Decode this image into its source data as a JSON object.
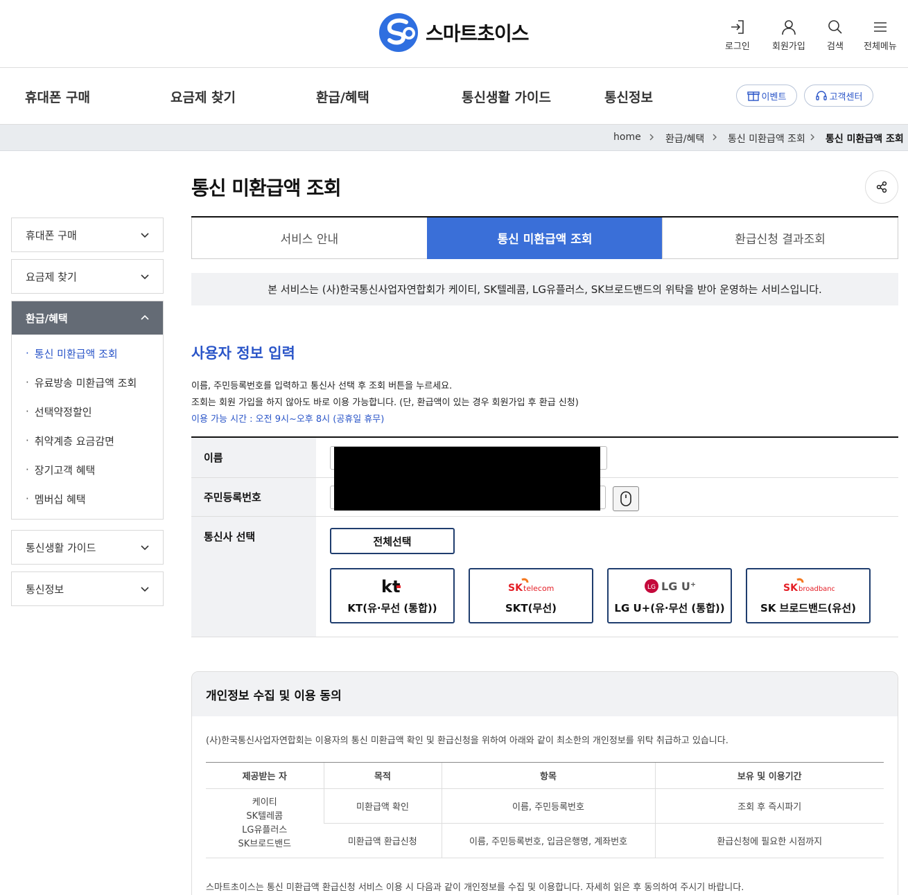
{
  "header": {
    "logo_text": "스마트초이스",
    "util": [
      {
        "label": "로그인",
        "icon": "login-icon"
      },
      {
        "label": "회원가입",
        "icon": "user-icon"
      },
      {
        "label": "검색",
        "icon": "search-icon"
      },
      {
        "label": "전체메뉴",
        "icon": "menu-icon"
      }
    ]
  },
  "gnb": {
    "items": [
      "휴대폰 구매",
      "요금제 찾기",
      "환급/혜택",
      "통신생활 가이드",
      "통신정보"
    ],
    "event_label": "이벤트",
    "support_label": "고객센터"
  },
  "breadcrumb": [
    "home",
    "환급/혜택",
    "통신 미환급액 조회",
    "통신 미환급액 조회"
  ],
  "sidebar": {
    "menus": [
      "휴대폰 구매",
      "요금제 찾기",
      "환급/혜택",
      "통신생활 가이드",
      "통신정보"
    ],
    "sub": [
      "통신 미환급액 조회",
      "유료방송 미환급액 조회",
      "선택약정할인",
      "취약계층 요금감면",
      "장기고객 혜택",
      "멤버십 혜택"
    ]
  },
  "page": {
    "title": "통신 미환급액 조회",
    "tabs": [
      "서비스 안내",
      "통신 미환급액 조회",
      "환급신청 결과조회"
    ],
    "notice": "본 서비스는 (사)한국통신사업자연합회가 케이티, SK텔레콤, LG유플러스, SK브로드밴드의 위탁을 받아 운영하는 서비스입니다.",
    "section_title": "사용자 정보 입력",
    "desc1": "이름, 주민등록번호를 입력하고 통신사 선택 후 조회 버튼을 누르세요.",
    "desc2": "조회는 회원 가입을 하지 않아도 바로 이용 가능합니다. (단, 환급액이 있는 경우 회원가입 후 환급 신청)",
    "hours": "이용 가능 시간 : 오전 9시~오후 8시 (공휴일 휴무)"
  },
  "form": {
    "name_label": "이름",
    "rrn_label": "주민등록번호",
    "carrier_label": "통신사 선택",
    "select_all": "전체선택",
    "carriers": [
      {
        "name": "KT(유·무선 (통합))",
        "logo": "kt"
      },
      {
        "name": "SKT(무선)",
        "logo": "SK telecom"
      },
      {
        "name": "LG U+(유·무선 (통합))",
        "logo": "LG U+"
      },
      {
        "name": "SK 브로드밴드(유선)",
        "logo": "SK broadband"
      }
    ]
  },
  "consent": {
    "title": "개인정보 수집 및 이용 동의",
    "intro": "(사)한국통신사업자연합회는 이용자의 통신 미환급액 확인 및 환급신청을 위하여 아래와 같이 최소한의 개인정보를 위탁 취급하고 있습니다.",
    "headers": [
      "제공받는 자",
      "목적",
      "항목",
      "보유 및 이용기간"
    ],
    "recipients": [
      "케이티",
      "SK텔레콤",
      "LG유플러스",
      "SK브로드밴드"
    ],
    "rows": [
      {
        "purpose": "미환급액 확인",
        "items": "이름, 주민등록번호",
        "period": "조회 후 즉시파기"
      },
      {
        "purpose": "미환급액 환급신청",
        "items": "이름, 주민등록번호, 입금은행명, 계좌번호",
        "period": "환급신청에 필요한 시점까지"
      }
    ],
    "footer": "스마트초이스는 통신 미환급액 환급신청 서비스 이용 시 다음과 같이 개인정보를 수집 및 이용합니다. 자세히 읽은 후 동의하여 주시기 바랍니다."
  },
  "colors": {
    "accent": "#3a6fd8",
    "brand_blue": "#2a55c8",
    "sidebar_active": "#646b75"
  }
}
